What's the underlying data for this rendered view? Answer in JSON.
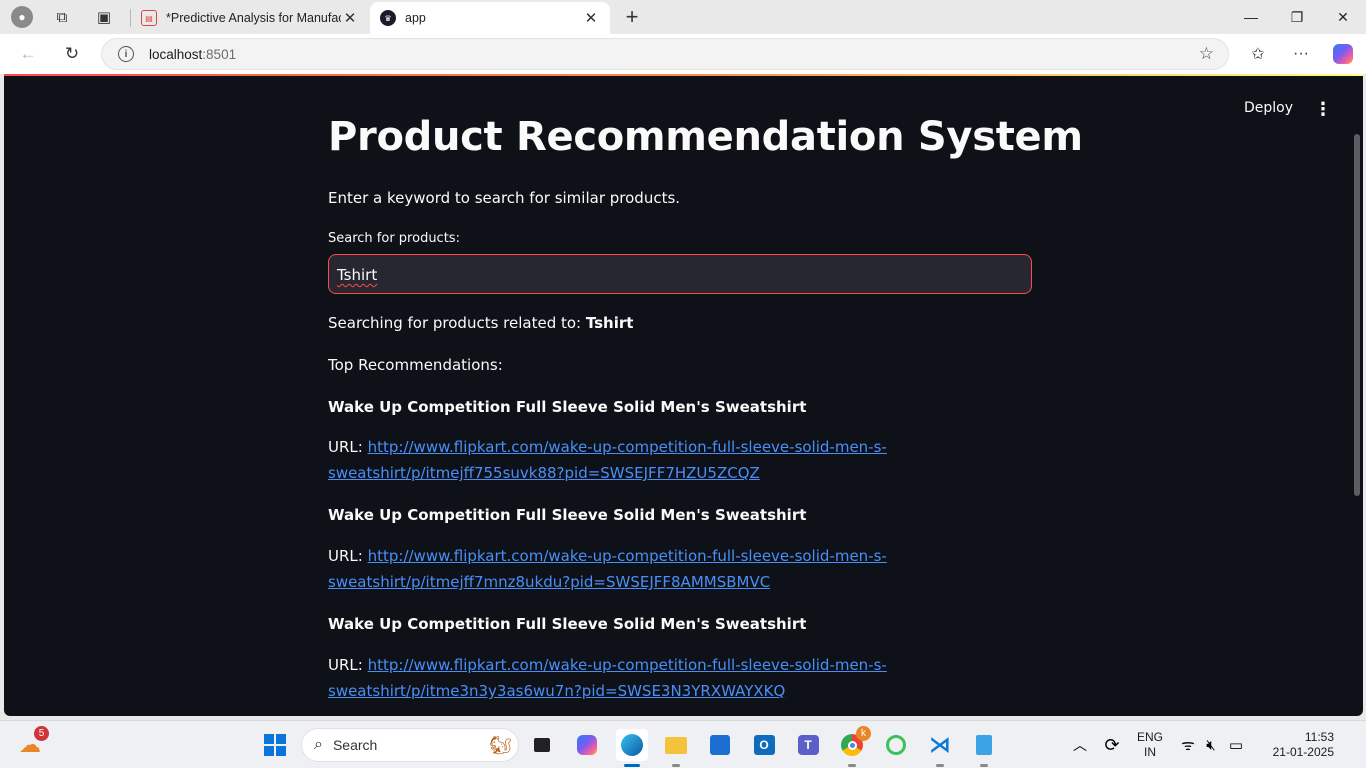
{
  "browser": {
    "tabs": [
      {
        "title": "*Predictive Analysis for Manufactu",
        "close": "✕"
      },
      {
        "title": "app",
        "close": "✕"
      }
    ],
    "address": {
      "host": "localhost",
      "port": ":8501"
    }
  },
  "app": {
    "deploy_label": "Deploy",
    "title": "Product Recommendation System",
    "intro": "Enter a keyword to search for similar products.",
    "search": {
      "label": "Search for products:",
      "value": "Tshirt"
    },
    "searching_prefix": "Searching for products related to: ",
    "searching_term": "Tshirt",
    "top_heading": "Top Recommendations:",
    "url_prefix": "URL: ",
    "results": [
      {
        "name": "Wake Up Competition Full Sleeve Solid Men's Sweatshirt",
        "url_line1": "http://www.flipkart.com/wake-up-competition-full-sleeve-solid-men-s-",
        "url_line2": "sweatshirt/p/itmejff755suvk88?pid=SWSEJFF7HZU5ZCQZ"
      },
      {
        "name": "Wake Up Competition Full Sleeve Solid Men's Sweatshirt",
        "url_line1": "http://www.flipkart.com/wake-up-competition-full-sleeve-solid-men-s-",
        "url_line2": "sweatshirt/p/itmejff7mnz8ukdu?pid=SWSEJFF8AMMSBMVC"
      },
      {
        "name": "Wake Up Competition Full Sleeve Solid Men's Sweatshirt",
        "url_line1": "http://www.flipkart.com/wake-up-competition-full-sleeve-solid-men-s-",
        "url_line2": "sweatshirt/p/itme3n3y3as6wu7n?pid=SWSE3N3YRXWAYXKQ"
      }
    ]
  },
  "taskbar": {
    "weather_badge": "5",
    "search_placeholder": "Search",
    "chrome_badge": "k",
    "lang_line1": "ENG",
    "lang_line2": "IN",
    "time": "11:53",
    "date": "21-01-2025"
  },
  "colors": {
    "app_bg": "#0e1117",
    "input_bg": "#262730",
    "accent": "#ff4b4b",
    "link": "#4a8ff7"
  }
}
